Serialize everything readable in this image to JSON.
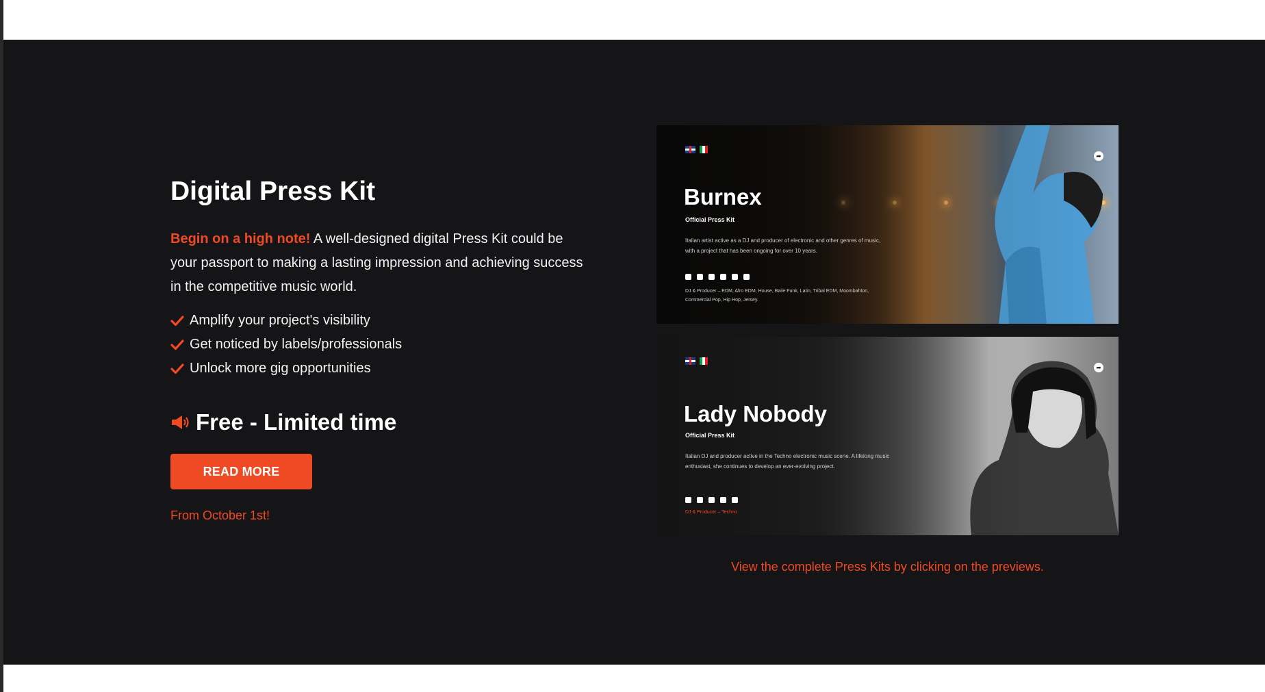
{
  "section": {
    "title": "Digital Press Kit",
    "intro_accent": "Begin on a high note!",
    "intro_text": " A well-designed digital Press Kit could be your passport to making a lasting impression and achieving success in the competitive music world.",
    "features": [
      "Amplify your project's visibility",
      "Get noticed by labels/professionals",
      "Unlock more gig opportunities"
    ],
    "free_label": "Free - Limited time",
    "read_more_label": "READ MORE",
    "from_date": "From October 1st!"
  },
  "previews": [
    {
      "name": "Burnex",
      "subtitle": "Official Press Kit",
      "description": "Italian artist active as a DJ and producer of electronic and other genres of music, with a project that has been ongoing for over 10 years.",
      "genre": "DJ & Producer – EDM, Afro EDM, House, Baile Funk, Latin, Tribal EDM, Moombahton, Commercial Pop, Hip Hop, Jersey."
    },
    {
      "name": "Lady Nobody",
      "subtitle": "Official Press Kit",
      "description": "Italian DJ and producer active in the Techno electronic music scene. A lifelong music enthusiast, she continues to develop an ever-evolving project.",
      "genre": "DJ & Producer – Techno"
    }
  ],
  "caption": "View the complete Press Kits by clicking on the previews.",
  "colors": {
    "accent": "#f04a24",
    "background": "#151517",
    "text": "#ffffff"
  },
  "icons": {
    "feature": "check-icon",
    "free": "megaphone-icon",
    "share": "share-icon"
  }
}
